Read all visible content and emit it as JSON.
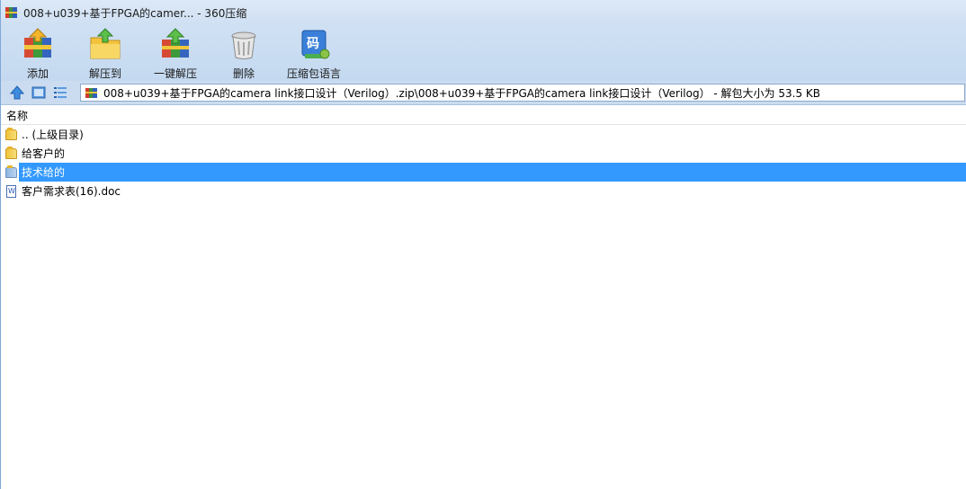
{
  "window": {
    "title": "008+u039+基于FPGA的camer... - 360压缩"
  },
  "toolbar": {
    "add_label": "添加",
    "extract_label": "解压到",
    "oneclick_label": "一键解压",
    "delete_label": "删除",
    "encoding_label": "压缩包语言",
    "encoding_badge": "码"
  },
  "address": {
    "path": "008+u039+基于FPGA的camera link接口设计（Verilog）.zip\\008+u039+基于FPGA的camera link接口设计（Verilog） - 解包大小为 53.5 KB"
  },
  "list": {
    "column_name": "名称",
    "rows": [
      {
        "name": ".. (上级目录)",
        "type": "folder"
      },
      {
        "name": "给客户的",
        "type": "folder"
      },
      {
        "name": "技术给的",
        "type": "folder",
        "selected": true
      },
      {
        "name": "客户需求表(16).doc",
        "type": "doc"
      }
    ]
  },
  "colors": {
    "selection": "#3399ff",
    "toolbar_bg": "#cfe0f3"
  }
}
